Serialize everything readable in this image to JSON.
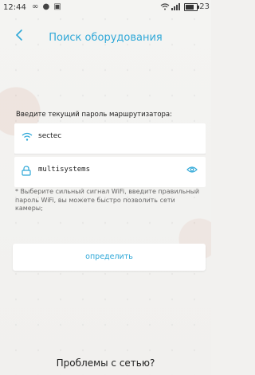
{
  "status_bar": {
    "time": "12:44",
    "left_icons": "∞ ● ▣",
    "battery_level": "23"
  },
  "nav": {
    "title": "Поиск оборудования"
  },
  "form": {
    "prompt": "Введите текущий пароль маршрутизатора:",
    "ssid": "sectec",
    "password": "multisystems",
    "hint": "* Выберите сильный сигнал WiFi, введите правильный пароль WiFi, вы можете быстро позволить сети камеры;"
  },
  "actions": {
    "confirm_label": "определить",
    "network_problem_label": "Проблемы с сетью?"
  },
  "colors": {
    "accent": "#2fa8d8",
    "background": "#f2f1ef",
    "card": "#ffffff"
  }
}
